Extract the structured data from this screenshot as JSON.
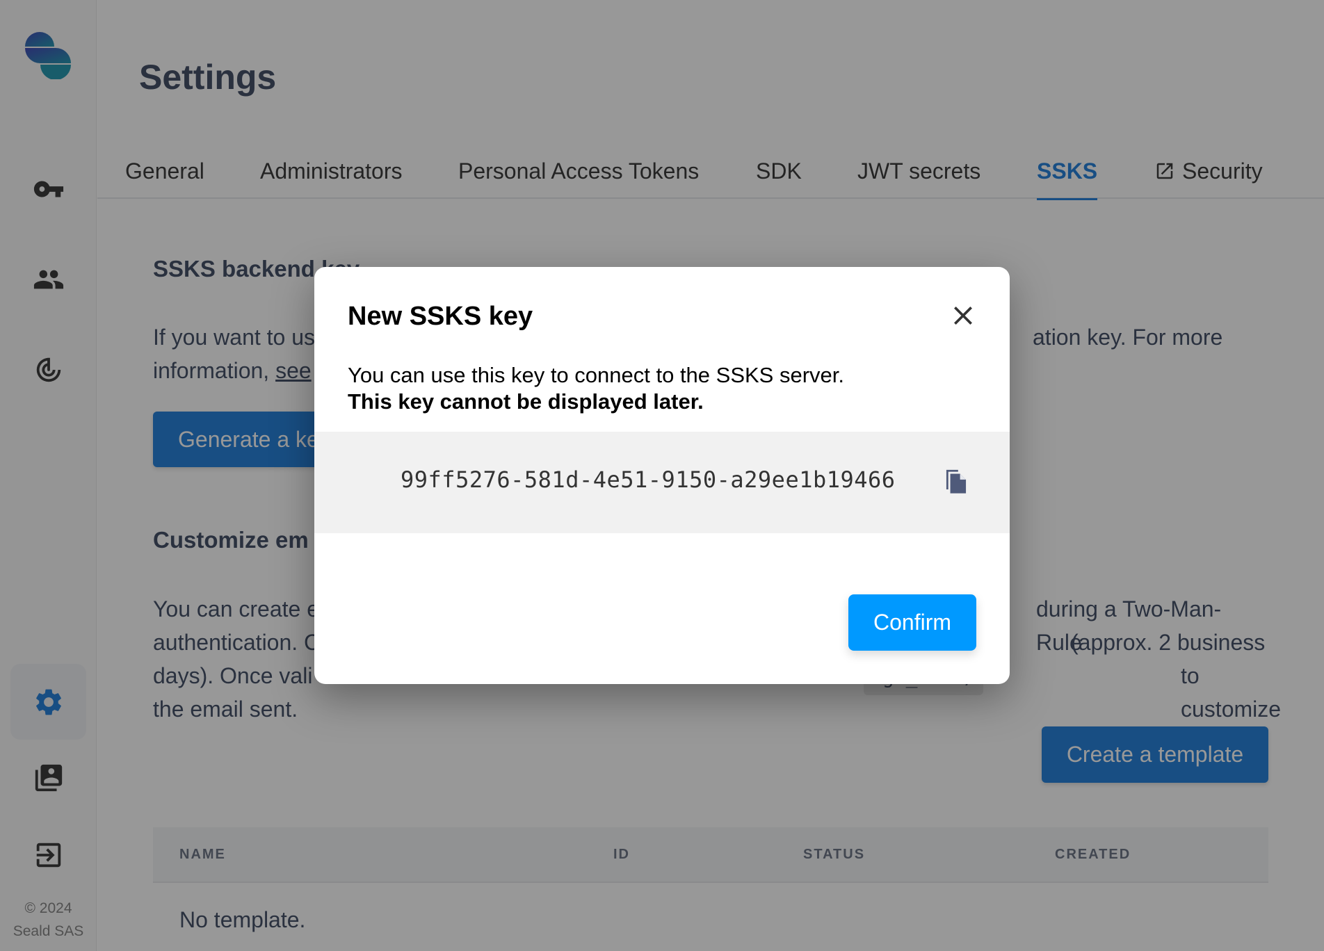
{
  "sidebar": {
    "items": [
      {
        "id": "keys",
        "icon": "key-icon"
      },
      {
        "id": "users",
        "icon": "group-icon"
      },
      {
        "id": "radar",
        "icon": "radar-icon"
      },
      {
        "id": "settings",
        "icon": "gear-icon",
        "active": true
      },
      {
        "id": "contacts",
        "icon": "contacts-icon"
      },
      {
        "id": "logout",
        "icon": "logout-icon"
      }
    ],
    "copyright_line1": "© 2024",
    "copyright_line2": "Seald SAS"
  },
  "header": {
    "title": "Settings"
  },
  "tabs": [
    {
      "label": "General"
    },
    {
      "label": "Administrators"
    },
    {
      "label": "Personal Access Tokens"
    },
    {
      "label": "SDK"
    },
    {
      "label": "JWT secrets"
    },
    {
      "label": "SSKS",
      "active": true
    },
    {
      "label": "Security",
      "external": true
    }
  ],
  "ssks_section": {
    "title": "SSKS backend key",
    "text_visible_left_1": "If you want to us",
    "text_visible_right_1": "ation key. For more",
    "text_visible_left_2": "information, ",
    "link_visible": "see",
    "generate_button": "Generate a ke"
  },
  "email_section": {
    "title": "Customize em",
    "line1_left": "You can create e",
    "line1_right": "during a Two-Man-Rule",
    "line2_left": "authentication. C",
    "line2_right": "(approx. 2 business",
    "line3_left": "days). Once vali",
    "line3_code": "nge_send/",
    "line3_right": "to customize",
    "line4": "the email sent.",
    "create_button": "Create a template"
  },
  "templates_table": {
    "columns": [
      "NAME",
      "ID",
      "STATUS",
      "CREATED"
    ],
    "empty_text": "No template."
  },
  "modal": {
    "title": "New SSKS key",
    "description": "You can use this key to connect to the SSKS server.",
    "warning": "This key cannot be displayed later.",
    "key": "99ff5276-581d-4e51-9150-a29ee1b19466",
    "confirm_label": "Confirm"
  },
  "colors": {
    "accent": "#0a72d6",
    "confirm": "#0099ff",
    "text": "#2d3b55"
  }
}
